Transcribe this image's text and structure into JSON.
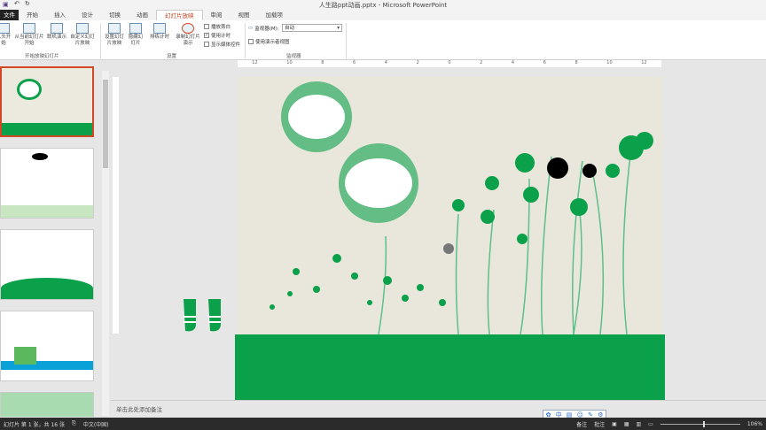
{
  "title": "人生路ppt动画.pptx - Microsoft PowerPoint",
  "tabs": [
    "文件",
    "开始",
    "插入",
    "设计",
    "切换",
    "动画",
    "幻灯片放映",
    "审阅",
    "视图",
    "加载项"
  ],
  "active_tab": "幻灯片放映",
  "ribbon": {
    "btn_from_start": "从头开始",
    "btn_from_current": "从当前幻灯片开始",
    "btn_online": "联机演示",
    "btn_custom": "自定义幻灯片放映",
    "group_start": "开始放映幻灯片",
    "btn_setup": "设置幻灯片放映",
    "btn_hide": "隐藏幻灯片",
    "btn_rehearse": "排练计时",
    "btn_record": "录制幻灯片演示",
    "chk_narration": "播放旁白",
    "chk_timing": "使用计时",
    "chk_media": "显示媒体控件",
    "group_setup": "设置",
    "monitor_label": "监视器(M):",
    "monitor_value": "自动",
    "chk_presenter": "使用演示者视图",
    "group_monitor": "监视器"
  },
  "ruler": [
    "12",
    "10",
    "8",
    "6",
    "4",
    "2",
    "0",
    "2",
    "4",
    "6",
    "8",
    "10",
    "12"
  ],
  "notes_placeholder": "单击此处添加备注",
  "status": {
    "slide": "幻灯片 第 1 张，共 16 张",
    "lang": "中文(中国)",
    "notes": "备注",
    "comments": "批注",
    "zoom": "106%"
  },
  "ime": [
    "中"
  ],
  "colors": {
    "accent": "#d24726",
    "green": "#0aa14a"
  }
}
